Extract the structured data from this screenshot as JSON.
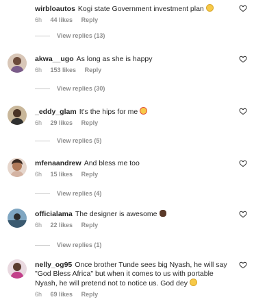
{
  "comments": [
    {
      "username": "wirbloautos",
      "text": "Kogi state Government investment plan",
      "emoji": "grin-emoji",
      "time": "6h",
      "likes": "44 likes",
      "reply": "Reply",
      "view_replies": "View replies (13)"
    },
    {
      "username": "akwa__ugo",
      "text": "As long as she is happy",
      "time": "6h",
      "likes": "153 likes",
      "reply": "Reply",
      "view_replies": "View replies (30)"
    },
    {
      "username": "_eddy_glam",
      "text": "It's the hips for me",
      "emoji": "heart-eyes-emoji",
      "time": "6h",
      "likes": "29 likes",
      "reply": "Reply",
      "view_replies": "View replies (5)"
    },
    {
      "username": "mfenaandrew",
      "text": "And bless me too",
      "time": "6h",
      "likes": "15 likes",
      "reply": "Reply",
      "view_replies": "View replies (4)"
    },
    {
      "username": "officialama",
      "text": "The designer is awesome",
      "emoji": "clapping-hands-emoji",
      "time": "6h",
      "likes": "22 likes",
      "reply": "Reply",
      "view_replies": "View replies (1)"
    },
    {
      "username": "nelly_og95",
      "text": "Once brother Tunde sees big Nyash, he will say \"God Bless Africa\" but when it comes to us with portable Nyash, he will pretend not to notice us. God dey",
      "emoji": "open-mouth-emoji",
      "time": "6h",
      "likes": "69 likes",
      "reply": "Reply"
    }
  ],
  "colors": {
    "text": "#262626",
    "meta": "#8e8e8e",
    "line": "#c7c7c7",
    "emoji_yellow": "#f7c948",
    "emoji_brown": "#5b3a29"
  }
}
